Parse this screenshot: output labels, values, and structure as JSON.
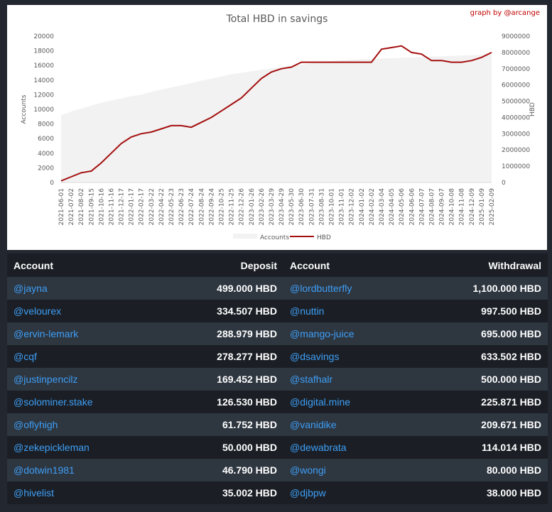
{
  "chart_data": {
    "type": "line",
    "title": "Total HBD in savings",
    "credit": "graph by @arcange",
    "ylabel_left": "Accounts",
    "ylabel_right": "HBD",
    "ylim_left": [
      0,
      20000
    ],
    "ylim_right": [
      0,
      9000000
    ],
    "yticks_left": [
      "0",
      "2000",
      "4000",
      "6000",
      "8000",
      "10000",
      "12000",
      "14000",
      "16000",
      "18000",
      "20000"
    ],
    "yticks_right": [
      "0",
      "1000000",
      "2000000",
      "3000000",
      "4000000",
      "5000000",
      "6000000",
      "7000000",
      "8000000",
      "9000000"
    ],
    "xticks": [
      "2021-06-01",
      "2021-07-02",
      "2021-08-02",
      "2021-09-15",
      "2021-10-16",
      "2021-11-16",
      "2021-12-17",
      "2022-01-17",
      "2022-02-17",
      "2022-03-22",
      "2022-04-22",
      "2022-05-23",
      "2022-06-23",
      "2022-07-24",
      "2022-08-24",
      "2022-09-24",
      "2022-10-25",
      "2022-11-25",
      "2022-12-26",
      "2023-01-26",
      "2023-02-26",
      "2023-03-29",
      "2023-04-29",
      "2023-05-30",
      "2023-06-30",
      "2023-07-31",
      "2023-08-31",
      "2023-10-01",
      "2023-11-01",
      "2023-12-02",
      "2024-01-02",
      "2024-02-02",
      "2024-03-04",
      "2024-04-05",
      "2024-05-06",
      "2024-06-06",
      "2024-07-07",
      "2024-08-07",
      "2024-09-07",
      "2024-10-08",
      "2024-11-08",
      "2024-12-09",
      "2025-01-09",
      "2025-02-09"
    ],
    "series": [
      {
        "name": "Accounts",
        "axis": "left",
        "color": "#f2f2f2",
        "values": [
          9200,
          9700,
          10100,
          10500,
          10900,
          11200,
          11500,
          11800,
          12000,
          12400,
          12700,
          13000,
          13300,
          13600,
          13900,
          14200,
          14500,
          14800,
          15000,
          15200,
          15400,
          15600,
          15800,
          15900,
          16100,
          16300,
          16500,
          16600,
          16700,
          16800,
          16850,
          16900,
          16950,
          17000,
          17050,
          17100,
          17150,
          17200,
          17250,
          17300,
          17350,
          17400,
          17450,
          17500
        ]
      },
      {
        "name": "HBD",
        "axis": "right",
        "color": "#a50f0f",
        "values": [
          100000,
          350000,
          600000,
          700000,
          1200000,
          1800000,
          2400000,
          2800000,
          3000000,
          3100000,
          3300000,
          3500000,
          3500000,
          3400000,
          3700000,
          4000000,
          4400000,
          4800000,
          5200000,
          5800000,
          6400000,
          6800000,
          7000000,
          7100000,
          7400000,
          7400000,
          7400000,
          7400000,
          7400000,
          7400000,
          7400000,
          7400000,
          8200000,
          8300000,
          8400000,
          8000000,
          7900000,
          7500000,
          7500000,
          7400000,
          7400000,
          7500000,
          7700000,
          8000000
        ]
      }
    ]
  },
  "table": {
    "headers": {
      "account1": "Account",
      "deposit": "Deposit",
      "account2": "Account",
      "withdrawal": "Withdrawal"
    },
    "rows": [
      {
        "dep_account": "@jayna",
        "deposit": "499.000 HBD",
        "wd_account": "@lordbutterfly",
        "withdrawal": "1,100.000 HBD"
      },
      {
        "dep_account": "@velourex",
        "deposit": "334.507 HBD",
        "wd_account": "@nuttin",
        "withdrawal": "997.500 HBD"
      },
      {
        "dep_account": "@ervin-lemark",
        "deposit": "288.979 HBD",
        "wd_account": "@mango-juice",
        "withdrawal": "695.000 HBD"
      },
      {
        "dep_account": "@cqf",
        "deposit": "278.277 HBD",
        "wd_account": "@dsavings",
        "withdrawal": "633.502 HBD"
      },
      {
        "dep_account": "@justinpencilz",
        "deposit": "169.452 HBD",
        "wd_account": "@stafhalr",
        "withdrawal": "500.000 HBD"
      },
      {
        "dep_account": "@solominer.stake",
        "deposit": "126.530 HBD",
        "wd_account": "@digital.mine",
        "withdrawal": "225.871 HBD"
      },
      {
        "dep_account": "@oflyhigh",
        "deposit": "61.752 HBD",
        "wd_account": "@vanidike",
        "withdrawal": "209.671 HBD"
      },
      {
        "dep_account": "@zekepickleman",
        "deposit": "50.000 HBD",
        "wd_account": "@dewabrata",
        "withdrawal": "114.014 HBD"
      },
      {
        "dep_account": "@dotwin1981",
        "deposit": "46.790 HBD",
        "wd_account": "@wongi",
        "withdrawal": "80.000 HBD"
      },
      {
        "dep_account": "@hivelist",
        "deposit": "35.002 HBD",
        "wd_account": "@djbpw",
        "withdrawal": "38.000 HBD"
      }
    ]
  }
}
